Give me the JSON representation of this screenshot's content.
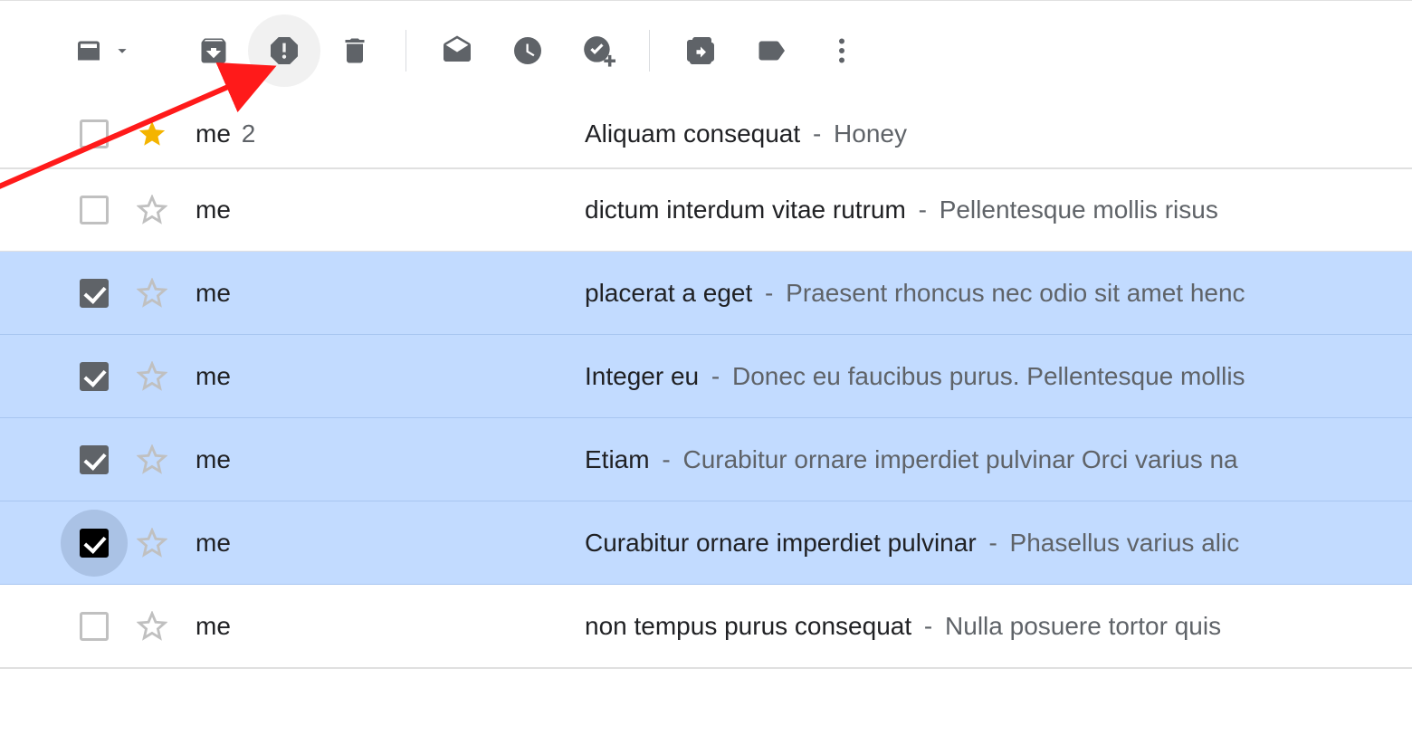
{
  "toolbar": {
    "select_icon": "select",
    "dropdown_icon": "dropdown",
    "archive_icon": "archive",
    "spam_icon": "report-spam",
    "delete_icon": "delete",
    "markread_icon": "mark-as-read",
    "snooze_icon": "snooze",
    "addtask_icon": "add-to-tasks",
    "moveto_icon": "move-to",
    "labels_icon": "labels",
    "more_icon": "more"
  },
  "emails": [
    {
      "sender": "me",
      "count": "2",
      "starred": true,
      "checked": false,
      "selected": false,
      "subject": "Aliquam consequat",
      "snippet": "Honey"
    },
    {
      "sender": "me",
      "count": "",
      "starred": false,
      "checked": false,
      "selected": false,
      "subject": "dictum interdum vitae rutrum",
      "snippet": "Pellentesque mollis risus"
    },
    {
      "sender": "me",
      "count": "",
      "starred": false,
      "checked": true,
      "selected": true,
      "subject": "placerat a eget",
      "snippet": "Praesent rhoncus nec odio sit amet henc"
    },
    {
      "sender": "me",
      "count": "",
      "starred": false,
      "checked": true,
      "selected": true,
      "subject": "Integer eu",
      "snippet": "Donec eu faucibus purus. Pellentesque mollis"
    },
    {
      "sender": "me",
      "count": "",
      "starred": false,
      "checked": true,
      "selected": true,
      "subject": "Etiam",
      "snippet": "Curabitur ornare imperdiet pulvinar Orci varius na"
    },
    {
      "sender": "me",
      "count": "",
      "starred": false,
      "checked": true,
      "selected": true,
      "subject": "Curabitur ornare imperdiet pulvinar",
      "snippet": "Phasellus varius alic",
      "focus": true
    },
    {
      "sender": "me",
      "count": "",
      "starred": false,
      "checked": false,
      "selected": false,
      "subject": "non tempus purus consequat",
      "snippet": "Nulla posuere tortor quis"
    }
  ]
}
